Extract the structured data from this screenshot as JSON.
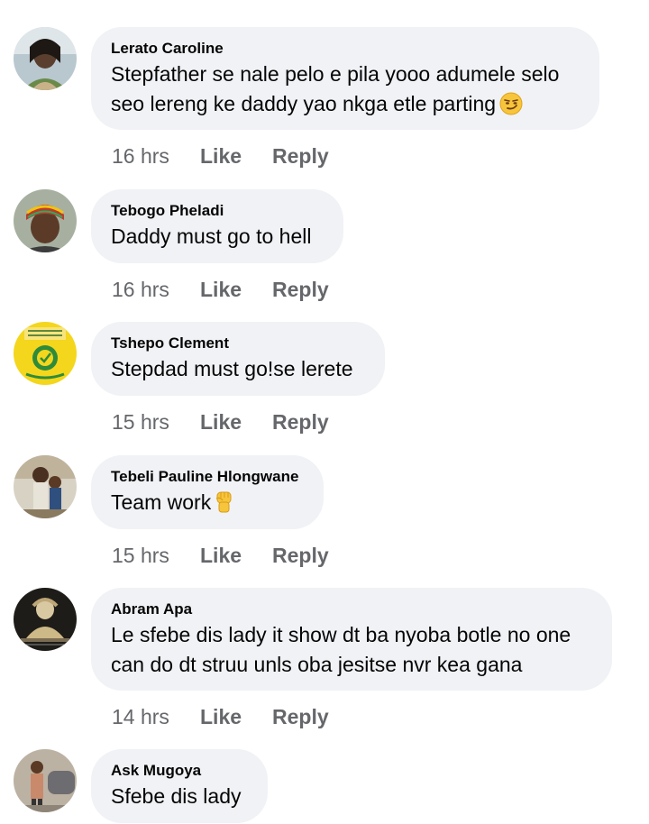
{
  "comments": [
    {
      "author": "Lerato Caroline",
      "lines": [
        "Stepfather se nale pelo e pila yooo adumele selo",
        "seo lereng ke daddy yao nkga etle parting"
      ],
      "emoji": "smirk-face-emoji",
      "time": "16 hrs",
      "like": "Like",
      "reply": "Reply",
      "avatar_color": "#6b5a4c"
    },
    {
      "author": "Tebogo Pheladi",
      "lines": [
        "Daddy must go to hell"
      ],
      "time": "16 hrs",
      "like": "Like",
      "reply": "Reply",
      "avatar_color": "#3a2a22"
    },
    {
      "author": "Tshepo Clement",
      "lines": [
        "Stepdad must go!se lerete"
      ],
      "time": "15 hrs",
      "like": "Like",
      "reply": "Reply",
      "avatar_color": "#f2d21a"
    },
    {
      "author": "Tebeli Pauline Hlongwane",
      "lines": [
        "Team work"
      ],
      "emoji": "raised-fist-emoji",
      "time": "15 hrs",
      "like": "Like",
      "reply": "Reply",
      "avatar_color": "#9c8a6e"
    },
    {
      "author": "Abram Apa",
      "lines": [
        "Le sfebe dis lady it show dt ba nyoba botle no one",
        "can do dt struu unls oba jesitse nvr kea gana"
      ],
      "time": "14 hrs",
      "like": "Like",
      "reply": "Reply",
      "avatar_color": "#2e2a22"
    },
    {
      "author": "Ask Mugoya",
      "lines": [
        "Sfebe dis lady"
      ],
      "avatar_color": "#a08d78"
    }
  ],
  "colors": {
    "bubble": "#f0f2f5",
    "text": "#050505",
    "meta": "#65676b"
  }
}
